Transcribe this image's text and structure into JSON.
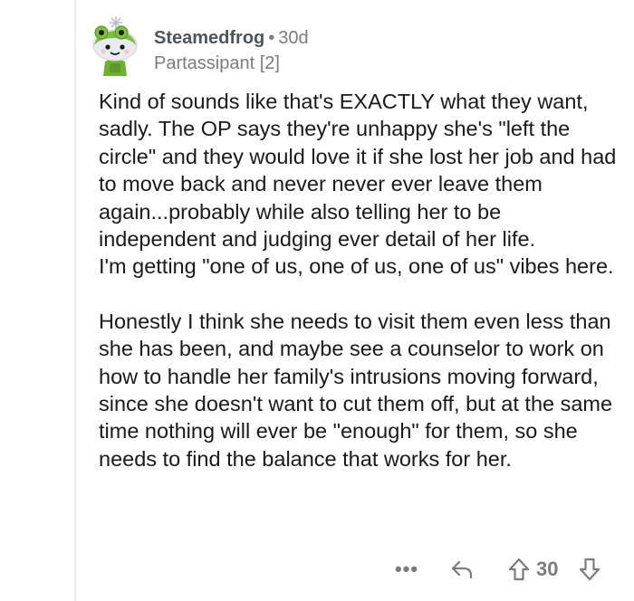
{
  "comment": {
    "author": "Steamedfrog",
    "separator": "•",
    "age": "30d",
    "flair": "Partassipant [2]",
    "paragraphs": [
      "Kind of sounds like that's EXACTLY what they want, sadly. The OP says they're unhappy she's \"left the circle\" and they would love it if she lost her job and had to move back and never never ever leave them again...probably while also telling her to be independent and judging ever detail of her life.\nI'm getting \"one of us, one of us, one of us\" vibes here.",
      "Honestly I think she needs to visit them even less than she has been, and maybe see a counselor to work on how to handle her family's intrusions moving forward, since she doesn't want to cut them off, but at the same time nothing will ever be \"enough\" for them, so she needs to find the balance that works for her."
    ]
  },
  "actions": {
    "more_label": "•••",
    "score": "30",
    "icons": [
      "more-options-icon",
      "reply-icon",
      "upvote-icon",
      "downvote-icon"
    ]
  },
  "colors": {
    "text": "#1a1a1b",
    "muted": "#7c7c7c",
    "thread_line": "#edeff1",
    "avatar_green": "#7fbf3f"
  }
}
